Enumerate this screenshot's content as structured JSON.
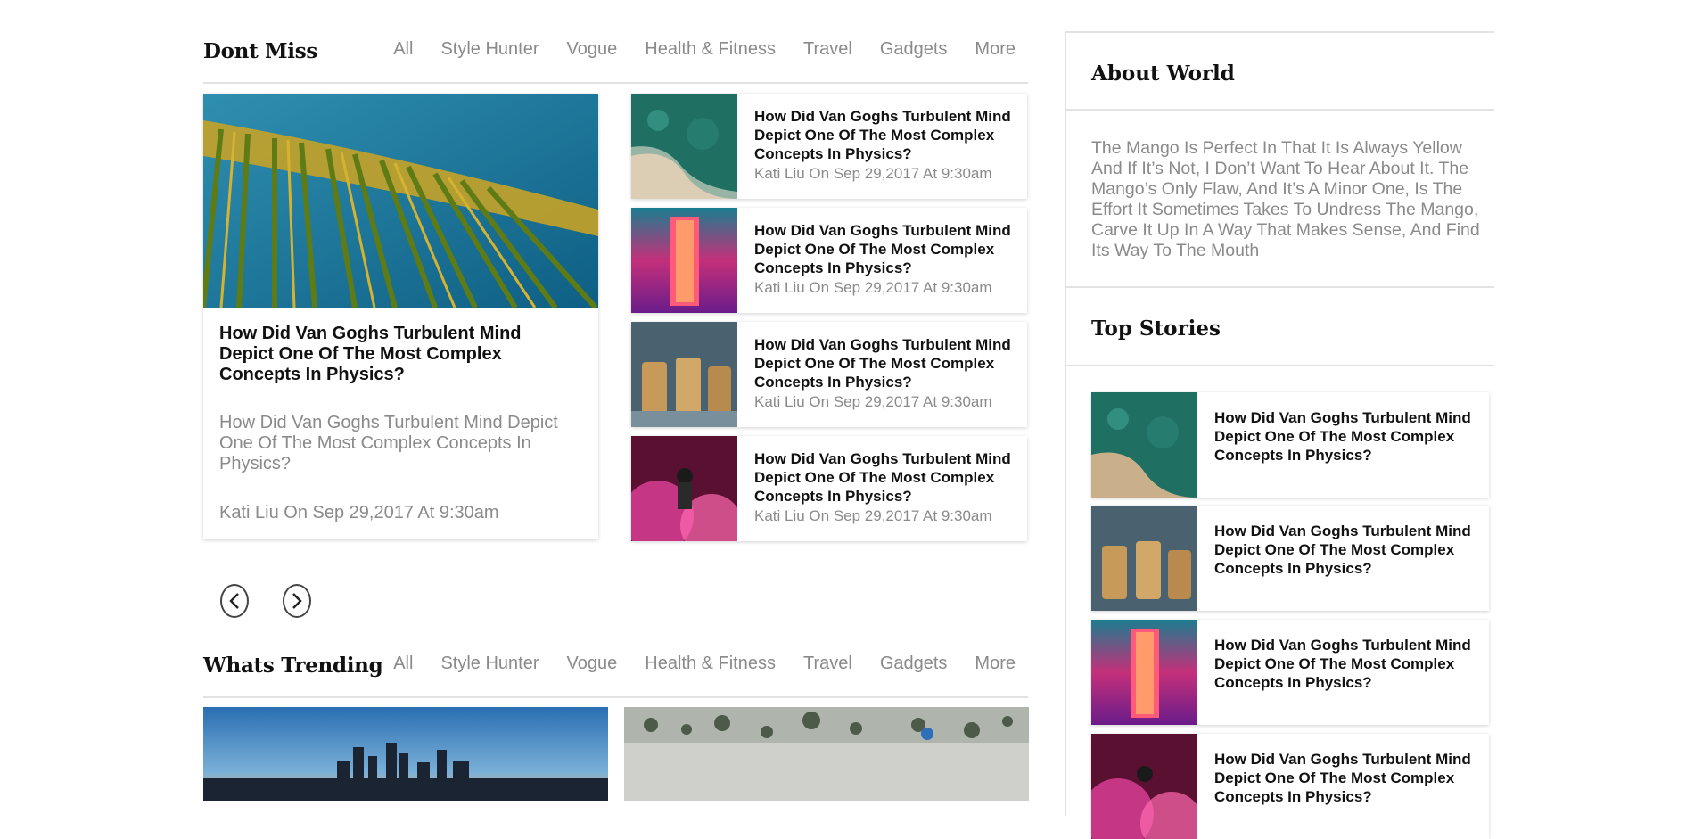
{
  "dont_miss": {
    "title": "Dont Miss",
    "categories": [
      "All",
      "Style Hunter",
      "Vogue",
      "Health & Fitness",
      "Travel",
      "Gadgets",
      "More"
    ],
    "featured": {
      "title": "How Did Van Goghs Turbulent Mind Depict One Of The Most Complex Concepts In Physics?",
      "description": "How Did Van Goghs Turbulent Mind Depict One Of The Most Complex Concepts In Physics?",
      "meta": "Kati Liu On Sep 29,2017 At 9:30am"
    },
    "articles": [
      {
        "title": "How Did Van Goghs Turbulent Mind Depict One Of The Most Complex Concepts In Physics?",
        "meta": "Kati Liu On Sep 29,2017 At 9:30am"
      },
      {
        "title": "How Did Van Goghs Turbulent Mind Depict One Of The Most Complex Concepts In Physics?",
        "meta": "Kati Liu On Sep 29,2017 At 9:30am"
      },
      {
        "title": "How Did Van Goghs Turbulent Mind Depict One Of The Most Complex Concepts In Physics?",
        "meta": "Kati Liu On Sep 29,2017 At 9:30am"
      },
      {
        "title": "How Did Van Goghs Turbulent Mind Depict One Of The Most Complex Concepts In Physics?",
        "meta": "Kati Liu On Sep 29,2017 At 9:30am"
      }
    ],
    "prev_icon": "chevron-left-icon",
    "next_icon": "chevron-right-icon"
  },
  "whats_trending": {
    "title": "Whats Trending",
    "categories": [
      "All",
      "Style Hunter",
      "Vogue",
      "Health & Fitness",
      "Travel",
      "Gadgets",
      "More"
    ]
  },
  "sidebar": {
    "about_title": "About World",
    "about_text": "The Mango Is Perfect In That It Is Always Yellow And If It’s Not, I Don’t Want To Hear About It. The Mango’s Only Flaw, And It’s A Minor One, Is The Effort It Sometimes Takes To Undress The Mango, Carve It Up In A Way That Makes Sense, And Find Its Way To The Mouth",
    "top_stories_title": "Top Stories",
    "top_stories": [
      {
        "title": "How Did Van Goghs Turbulent Mind Depict One Of The Most Complex Concepts In Physics?"
      },
      {
        "title": "How Did Van Goghs Turbulent Mind Depict One Of The Most Complex Concepts In Physics?"
      },
      {
        "title": "How Did Van Goghs Turbulent Mind Depict One Of The Most Complex Concepts In Physics?"
      },
      {
        "title": "How Did Van Goghs Turbulent Mind Depict One Of The Most Complex Concepts In Physics?"
      }
    ]
  },
  "colors": {
    "muted_text": "#8a8a8a",
    "heading_text": "#111111",
    "divider": "#e2e2e2"
  }
}
